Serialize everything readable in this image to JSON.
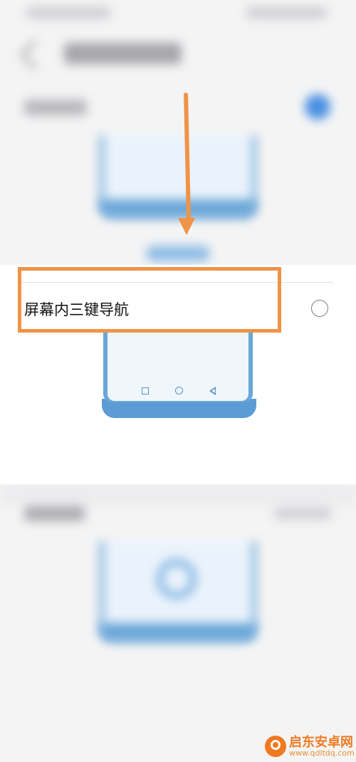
{
  "option": {
    "label": "屏幕内三键导航",
    "selected": false
  },
  "watermark": {
    "brand": "启东安卓网",
    "url": "www.qdltdq.com"
  },
  "colors": {
    "annotation": "#ef9347",
    "accent_blue": "#4a90e2",
    "phone_frame": "#6aa6d8"
  },
  "icons": [
    "back-arrow-icon",
    "nav-square-icon",
    "nav-circle-icon",
    "nav-back-icon",
    "watermark-logo-icon"
  ]
}
